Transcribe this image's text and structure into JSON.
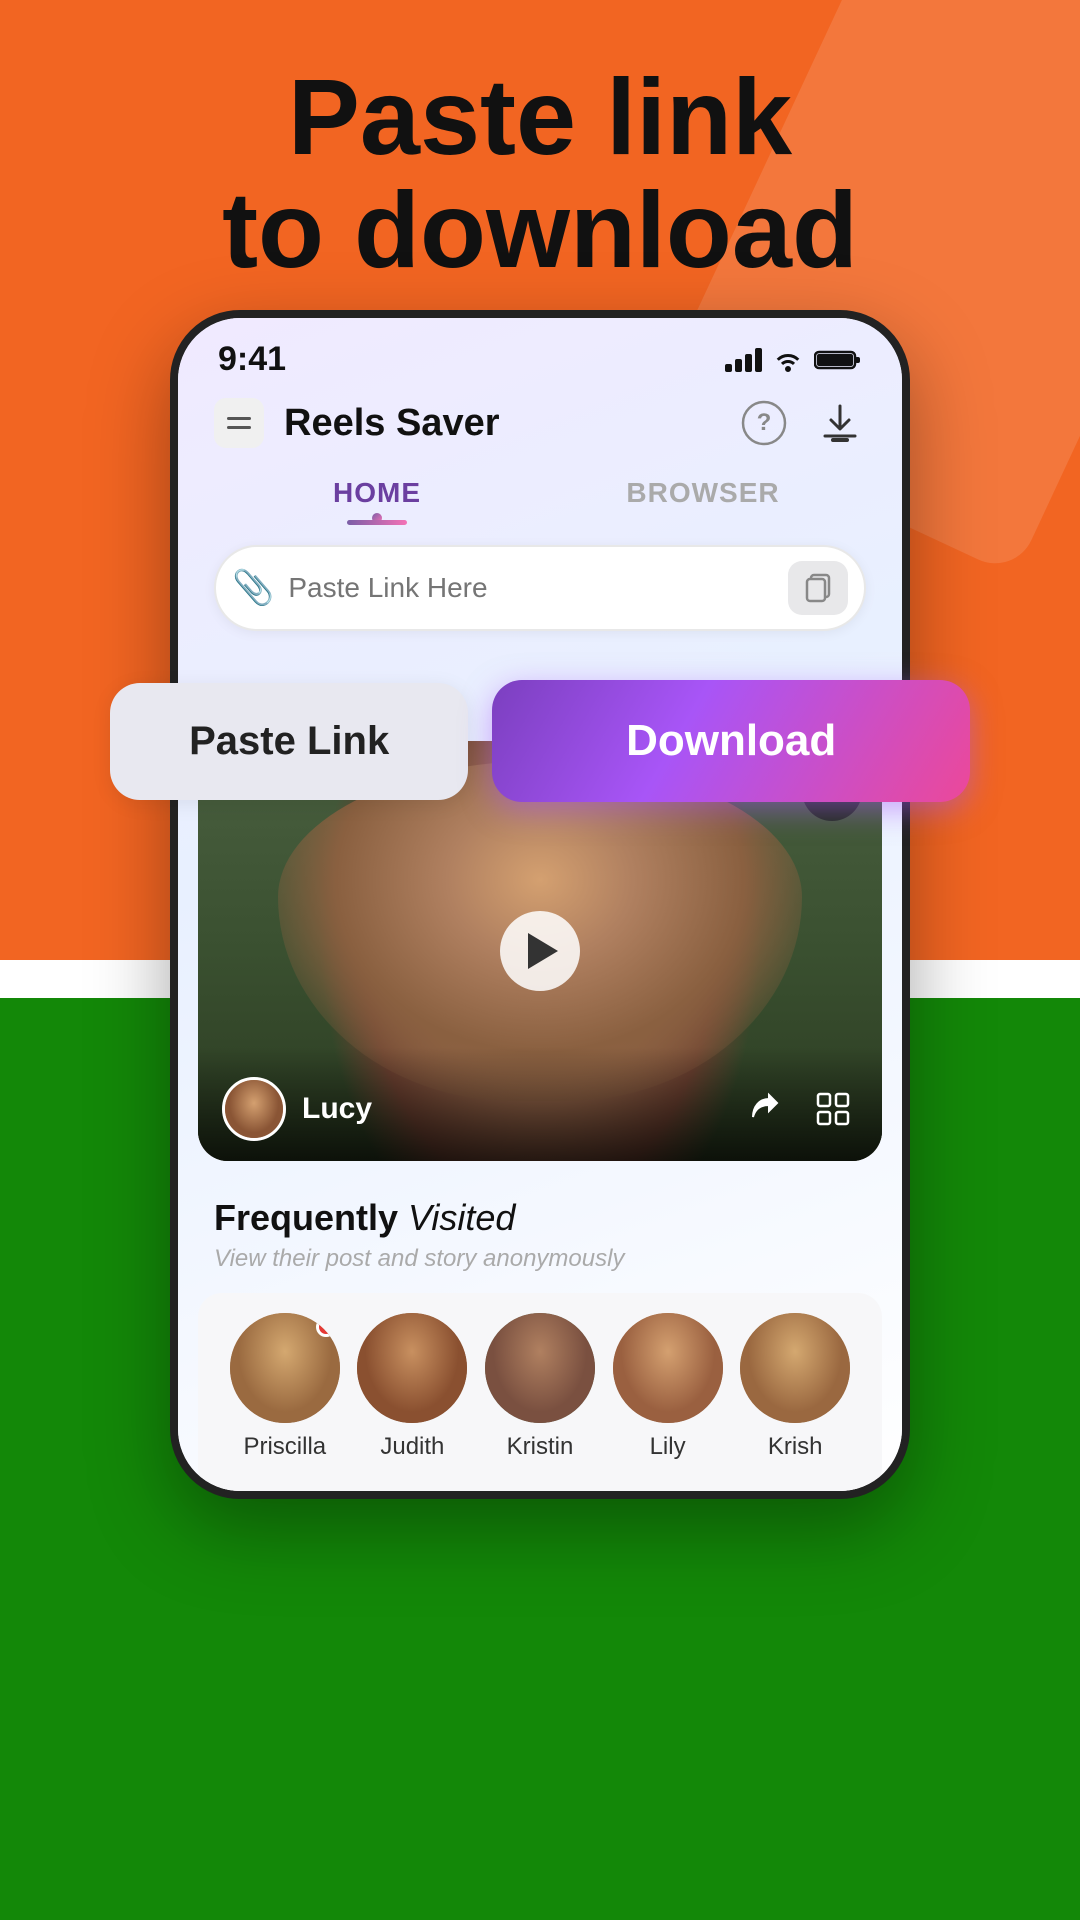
{
  "hero": {
    "title_line1": "Paste link",
    "title_line2": "to download"
  },
  "status_bar": {
    "time": "9:41"
  },
  "app_header": {
    "title": "Reels Saver",
    "tab_home": "HOME",
    "tab_browser": "BROWSER"
  },
  "paste_input": {
    "placeholder": "Paste Link Here"
  },
  "buttons": {
    "paste_link": "Paste Link",
    "download": "Download"
  },
  "video": {
    "username": "Lucy"
  },
  "frequently_visited": {
    "title_bold": "Frequently",
    "title_italic": "Visited",
    "subtitle": "View their post and story anonymously"
  },
  "users": [
    {
      "name": "Priscilla",
      "has_notification": true
    },
    {
      "name": "Judith",
      "has_notification": false
    },
    {
      "name": "Kristin",
      "has_notification": false
    },
    {
      "name": "Lily",
      "has_notification": false
    },
    {
      "name": "Krish",
      "has_notification": false
    }
  ]
}
